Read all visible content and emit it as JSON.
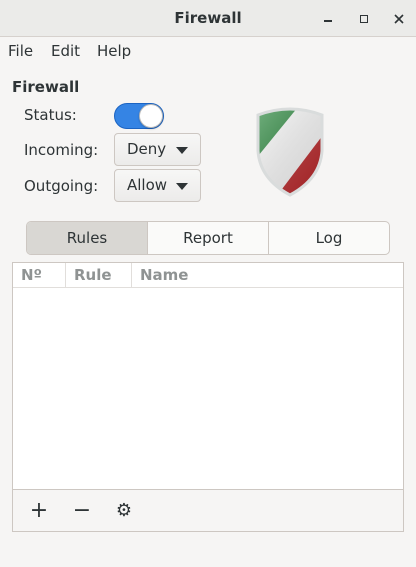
{
  "window": {
    "title": "Firewall",
    "controls": {
      "minimize_icon": "minimize-icon",
      "maximize_icon": "maximize-icon",
      "close_icon": "close-icon"
    }
  },
  "menu": {
    "file": "File",
    "edit": "Edit",
    "help": "Help"
  },
  "firewall": {
    "section_title": "Firewall",
    "status_label": "Status:",
    "status_on": true,
    "incoming_label": "Incoming:",
    "incoming_value": "Deny",
    "outgoing_label": "Outgoing:",
    "outgoing_value": "Allow",
    "shield_colors": {
      "green": "#2b8a3e",
      "white": "#ffffff",
      "red": "#c0282b"
    }
  },
  "tabs": [
    {
      "label": "Rules",
      "active": true
    },
    {
      "label": "Report",
      "active": false
    },
    {
      "label": "Log",
      "active": false
    }
  ],
  "table": {
    "columns": [
      "Nº",
      "Rule",
      "Name"
    ],
    "rows": []
  },
  "toolbar": {
    "add_symbol": "+",
    "remove_symbol": "−",
    "settings_symbol": "⚙"
  },
  "colors": {
    "accent": "#3584e4",
    "window_bg": "#f6f5f4"
  }
}
